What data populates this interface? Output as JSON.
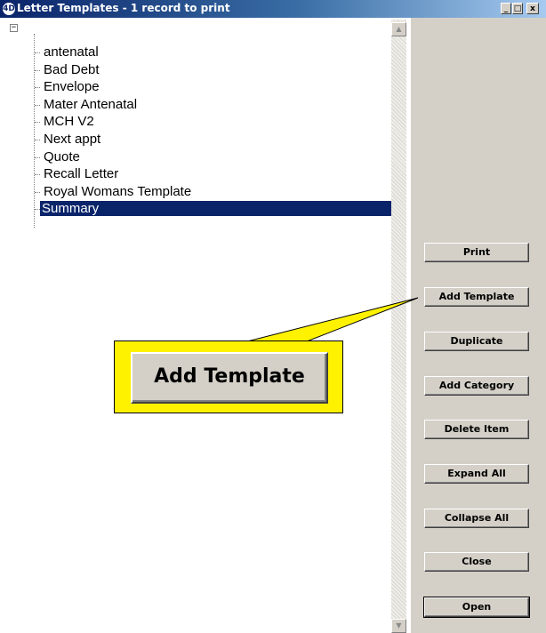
{
  "window": {
    "app_icon_text": "4D",
    "title": "Letter Templates - 1 record to print",
    "minimize_label": "_",
    "maximize_label": "□",
    "close_label": "x"
  },
  "tree": {
    "root_toggle": "−",
    "items": [
      {
        "label": "antenatal"
      },
      {
        "label": "Bad Debt"
      },
      {
        "label": "Envelope"
      },
      {
        "label": "Mater Antenatal"
      },
      {
        "label": "MCH V2"
      },
      {
        "label": "Next appt"
      },
      {
        "label": "Quote"
      },
      {
        "label": "Recall Letter"
      },
      {
        "label": "Royal Womans Template"
      },
      {
        "label": "Summary"
      }
    ],
    "selected_index": 9
  },
  "scrollbar": {
    "up_arrow": "▲",
    "down_arrow": "▼"
  },
  "buttons": {
    "print": "Print",
    "add_template": "Add Template",
    "duplicate": "Duplicate",
    "add_category": "Add Category",
    "delete_item": "Delete Item",
    "expand_all": "Expand All",
    "collapse_all": "Collapse All",
    "close": "Close",
    "open": "Open"
  },
  "callout": {
    "label": "Add Template",
    "color": "#fff200"
  },
  "colors": {
    "selection": "#0a246a",
    "panel": "#d4d0c8"
  }
}
